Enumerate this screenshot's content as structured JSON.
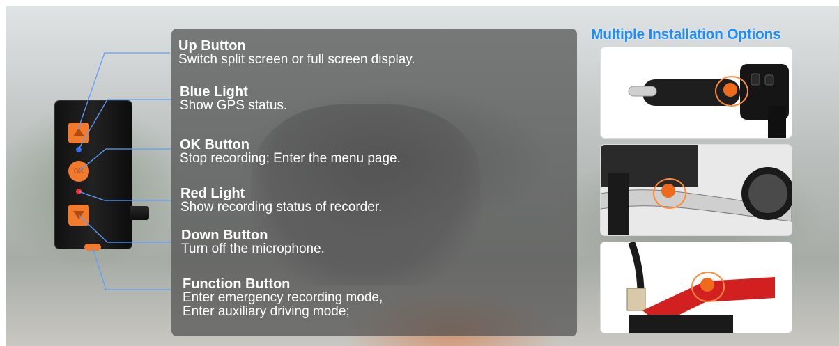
{
  "labels": [
    {
      "title": "Up Button",
      "desc": [
        "Switch  split screen or full screen display."
      ]
    },
    {
      "title": "Blue Light",
      "desc": [
        "Show GPS status."
      ]
    },
    {
      "title": "OK Button",
      "desc": [
        "Stop recording; Enter the menu page."
      ]
    },
    {
      "title": "Red Light",
      "desc": [
        "Show recording status of recorder."
      ]
    },
    {
      "title": "Down Button",
      "desc": [
        "Turn off the microphone."
      ]
    },
    {
      "title": "Function Button",
      "desc": [
        "Enter emergency recording mode,",
        "Enter auxiliary driving mode;"
      ]
    }
  ],
  "device": {
    "ok_label": "OK"
  },
  "options": {
    "title": "Multiple Installation Options"
  },
  "colors": {
    "accent_orange": "#f27a2d",
    "title_blue": "#1f8cff",
    "line_blue": "#5aa0ff",
    "gps_light": "#2d6cff",
    "rec_light": "#ff2a2a"
  }
}
